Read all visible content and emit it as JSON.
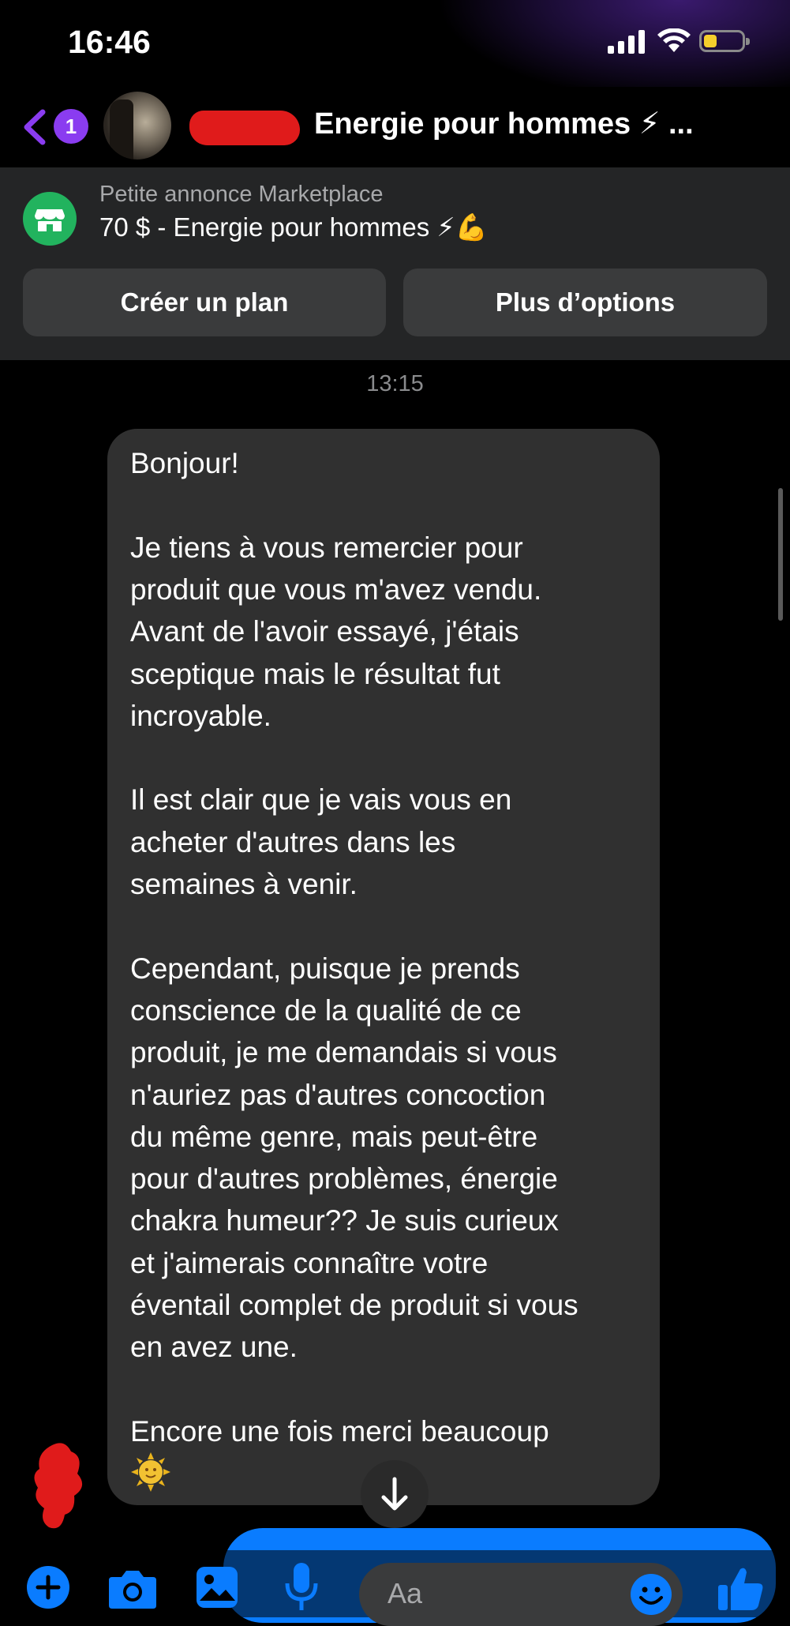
{
  "status_bar": {
    "time": "16:46"
  },
  "header": {
    "back_badge": "1",
    "title": "Energie pour hommes ⚡ ..."
  },
  "banner": {
    "subtitle": "Petite annonce Marketplace",
    "listing": "70 $ - Energie pour hommes ⚡💪",
    "buttons": {
      "plan": "Créer un plan",
      "options": "Plus d’options"
    }
  },
  "conversation": {
    "timestamp": "13:15",
    "message_lines": [
      "Bonjour!",
      "",
      "Je tiens à vous remercier pour",
      "produit que vous m'avez vendu.",
      "Avant de l'avoir essayé, j'étais",
      "sceptique mais le résultat fut",
      "incroyable.",
      "",
      "Il est clair que je vais vous en",
      "acheter d'autres dans les",
      "semaines à venir.",
      "",
      "Cependant, puisque je prends",
      "conscience de la qualité de ce",
      "produit, je me demandais si vous",
      "n'auriez pas d'autres concoction",
      "du même genre, mais peut-être",
      "pour d'autres problèmes, énergie",
      "chakra humeur??  Je suis curieux",
      "et j'aimerais connaître votre",
      "éventail complet de produit si vous",
      "en avez une.",
      "",
      "Encore une fois merci beaucoup"
    ],
    "message_emoji": "sun-with-face-icon"
  },
  "composer": {
    "placeholder": "Aa"
  },
  "colors": {
    "accent": "#0a7cff",
    "badge": "#8a3cf0",
    "marketplace": "#22b35e",
    "bubble": "#303030",
    "redaction": "#e01b1b"
  }
}
